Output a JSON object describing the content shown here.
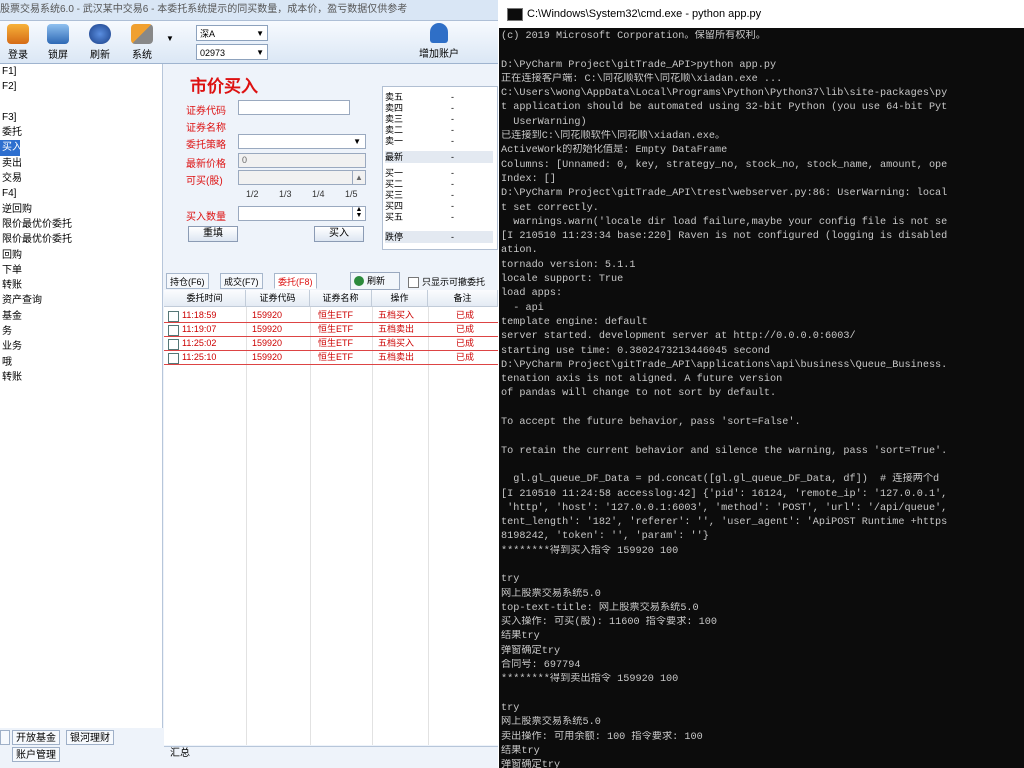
{
  "app": {
    "title_text": "股票交易系统6.0 - 武汉某中交易6 - 本委托系统提示的同买数量，成本价，盈亏数据仅供参考"
  },
  "toolbar": {
    "buttons": [
      "登录",
      "锁屏",
      "刷新",
      "系统"
    ],
    "market_select": "深A",
    "account_select": "02973",
    "add_account_label": "增加账户"
  },
  "nav": {
    "items": [
      "F1]",
      "F2]",
      "",
      "F3]",
      "委托",
      "买入",
      "卖出",
      "交易",
      "F4]",
      "逆回购",
      "限价最优价委托",
      "限价最优价委托",
      "回购",
      "下单",
      "转账",
      "资产查询",
      "基金",
      "务",
      "业务",
      "哦",
      "转账"
    ],
    "selected_index": 5,
    "bottom_tabs": [
      "开放基金",
      "银河理财",
      "账户管理"
    ]
  },
  "order_form": {
    "title": "市价买入",
    "labels": {
      "code": "证券代码",
      "name": "证券名称",
      "strategy": "委托策略",
      "last_price": "最新价格",
      "available": "可买(股)",
      "quantity": "买入数量"
    },
    "last_price_value": "0",
    "fractions": [
      "1/2",
      "1/3",
      "1/4",
      "1/5"
    ],
    "reset_button": "重填",
    "buy_button": "买入"
  },
  "quote": {
    "sell_rows": [
      "卖五",
      "卖四",
      "卖三",
      "卖二",
      "卖一"
    ],
    "latest_label": "最新",
    "buy_rows": [
      "买一",
      "买二",
      "买三",
      "买四",
      "买五"
    ],
    "limit_down_label": "跌停",
    "placeholder": "-"
  },
  "orders_panel": {
    "tabs": [
      "持仓(F6)",
      "成交(F7)",
      "委托(F8)"
    ],
    "active_tab": 2,
    "refresh_label": "刷新",
    "only_cancelable_label": "只显示可撤委托",
    "columns": [
      "委托时间",
      "证券代码",
      "证券名称",
      "操作",
      "备注"
    ],
    "rows": [
      {
        "time": "11:18:59",
        "code": "159920",
        "name": "恒生ETF",
        "op": "五档买入",
        "note": "已成"
      },
      {
        "time": "11:19:07",
        "code": "159920",
        "name": "恒生ETF",
        "op": "五档卖出",
        "note": "已成"
      },
      {
        "time": "11:25:02",
        "code": "159920",
        "name": "恒生ETF",
        "op": "五档买入",
        "note": "已成"
      },
      {
        "time": "11:25:10",
        "code": "159920",
        "name": "恒生ETF",
        "op": "五档卖出",
        "note": "已成"
      }
    ],
    "status_text": "汇总"
  },
  "console": {
    "window_title": "C:\\Windows\\System32\\cmd.exe - python  app.py",
    "lines": [
      "(c) 2019 Microsoft Corporation。保留所有权利。",
      "",
      "D:\\PyCharm Project\\gitTrade_API>python app.py",
      "正在连接客户端: C:\\同花顺软件\\同花顺\\xiadan.exe ...",
      "C:\\Users\\wong\\AppData\\Local\\Programs\\Python\\Python37\\lib\\site-packages\\py",
      "t application should be automated using 32-bit Python (you use 64-bit Pyt",
      "  UserWarning)",
      "已连接到C:\\同花顺软件\\同花顺\\xiadan.exe。",
      "ActiveWork的初始化值是: Empty DataFrame",
      "Columns: [Unnamed: 0, key, strategy_no, stock_no, stock_name, amount, ope",
      "Index: []",
      "D:\\PyCharm Project\\gitTrade_API\\trest\\webserver.py:86: UserWarning: local",
      "t set correctly.",
      "  warnings.warn('locale dir load failure,maybe your config file is not se",
      "[I 210510 11:23:34 base:220] Raven is not configured (logging is disabled",
      "ation.",
      "tornado version: 5.1.1",
      "locale support: True",
      "load apps:",
      "  - api",
      "template engine: default",
      "server started. development server at http://0.0.0.0:6003/",
      "starting use time: 0.3802473213446045 second",
      "D:\\PyCharm Project\\gitTrade_API\\applications\\api\\business\\Queue_Business.",
      "tenation axis is not aligned. A future version",
      "of pandas will change to not sort by default.",
      "",
      "To accept the future behavior, pass 'sort=False'.",
      "",
      "To retain the current behavior and silence the warning, pass 'sort=True'.",
      "",
      "  gl.gl_queue_DF_Data = pd.concat([gl.gl_queue_DF_Data, df])  # 连接两个d",
      "[I 210510 11:24:58 accesslog:42] {'pid': 16124, 'remote_ip': '127.0.0.1',",
      " 'http', 'host': '127.0.0.1:6003', 'method': 'POST', 'url': '/api/queue',",
      "tent_length': '182', 'referer': '', 'user_agent': 'ApiPOST Runtime +https",
      "8198242, 'token': '', 'param': ''}",
      "********得到买入指令 159920 100",
      "",
      "try",
      "网上股票交易系统5.0",
      "top-text-title: 网上股票交易系统5.0",
      "买入操作: 可买(股): 11600 指令要求: 100",
      "结果try",
      "弹窗确定try",
      "合同号: 697794",
      "********得到卖出指令 159920 100",
      "",
      "try",
      "网上股票交易系统5.0",
      "卖出操作: 可用余额: 100 指令要求: 100",
      "结果try",
      "弹窗确定try",
      "合同号: 698185"
    ]
  }
}
